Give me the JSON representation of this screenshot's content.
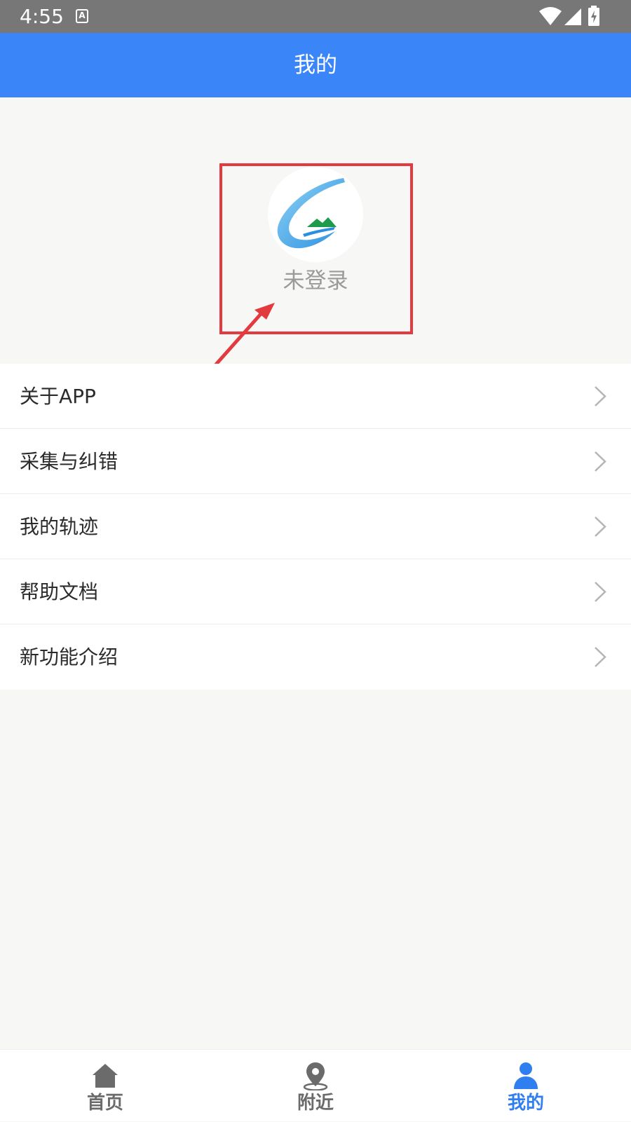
{
  "status_bar": {
    "time": "4:55",
    "notification_letter": "A"
  },
  "header": {
    "title": "我的"
  },
  "profile": {
    "status_text": "未登录"
  },
  "menu": {
    "items": [
      {
        "label": "关于APP"
      },
      {
        "label": "采集与纠错"
      },
      {
        "label": "我的轨迹"
      },
      {
        "label": "帮助文档"
      },
      {
        "label": "新功能介绍"
      }
    ]
  },
  "bottom_nav": {
    "items": [
      {
        "label": "首页",
        "icon": "home-icon"
      },
      {
        "label": "附近",
        "icon": "location-pin-icon"
      },
      {
        "label": "我的",
        "icon": "person-icon",
        "active": true
      }
    ]
  },
  "colors": {
    "header_bg": "#3a86f8",
    "active_tab": "#2f7ff0",
    "highlight": "#e23a3f"
  }
}
